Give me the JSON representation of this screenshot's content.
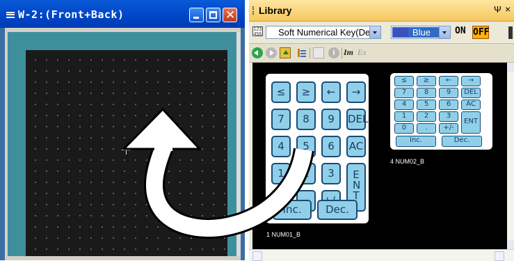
{
  "window": {
    "title": "W-2:(Front+Back)",
    "buttons": {
      "minimize": "_",
      "maximize": "□",
      "close": "✕"
    }
  },
  "library": {
    "title": "Library",
    "pin_glyph": "Ψ",
    "close_glyph": "×",
    "type_select": "Soft Numerical Key(Dec.",
    "color_select": "Blue",
    "on_label": "ON",
    "off_label": "OFF",
    "toolbar": {
      "im_label": "Im",
      "ex_label": "Ex",
      "info_glyph": "i"
    },
    "items": [
      {
        "caption": "1 NUM01_B",
        "keys": [
          "≤",
          "≥",
          "←",
          "→",
          "7",
          "8",
          "9",
          "DEL",
          "4",
          "5",
          "6",
          "AC",
          "1",
          "2",
          "3",
          "ENT",
          "0",
          ".",
          "+/-",
          "Inc.",
          "Dec."
        ]
      },
      {
        "caption": "4 NUM02_B",
        "keys": [
          "≤",
          "≥",
          "←",
          "→",
          "7",
          "8",
          "9",
          "DEL",
          "4",
          "5",
          "6",
          "AC",
          "1",
          "2",
          "3",
          "ENT",
          "0",
          ".",
          "+/-",
          "Inc.",
          "Dec."
        ]
      }
    ]
  },
  "colors": {
    "title_blue": "#0046c8",
    "canvas_bg": "#1a1a1a",
    "key_fill": "#8fd0e8",
    "key_border": "#1a4a7a",
    "off_accent": "#ffb000"
  },
  "icons": {
    "window_icon": "window-icon",
    "back": "back-arrow-icon",
    "forward": "forward-arrow-icon",
    "folder_up": "folder-up-icon",
    "tree": "tree-view-icon",
    "copy": "copy-icon",
    "info": "info-icon",
    "import": "import-icon",
    "export": "export-icon",
    "drag": "drag-arrow-icon"
  }
}
